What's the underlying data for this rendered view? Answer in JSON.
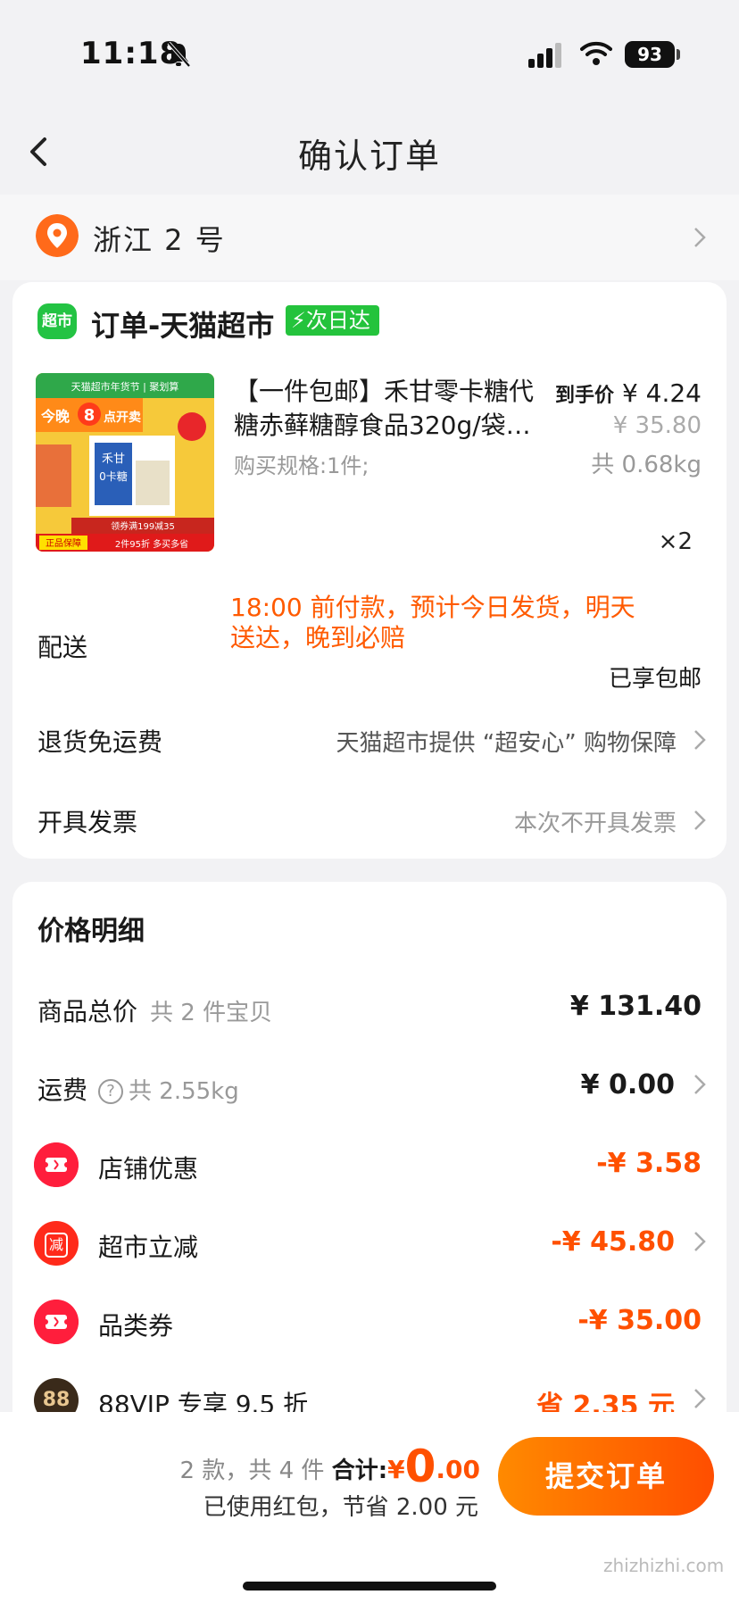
{
  "status_bar": {
    "time": "11:18",
    "battery": "93"
  },
  "nav": {
    "title": "确认订单"
  },
  "address": {
    "text": "浙江 2 号"
  },
  "order": {
    "shop_logo": "超市",
    "shop_name": "订单-天猫超市",
    "badge": "次日达",
    "product": {
      "title": "【一件包邮】禾甘零卡糖代糖赤藓糖醇食品320g/袋…",
      "spec": "购买规格:1件;",
      "final_price_label": "到手价",
      "final_price": "¥ 4.24",
      "original_price": "¥ 35.80",
      "weight": "共 0.68kg",
      "quantity": "×2",
      "image_texts": [
        "天猫超市年货节 | 聚划算",
        "今晚",
        "8",
        "点开卖",
        "禾甘",
        "0卡糖",
        "领券满199减35",
        "正品保障",
        "2件95折 多买多省"
      ]
    },
    "delivery": {
      "label": "配送",
      "note": "18:00 前付款，预计今日发货，明天送达，晚到必赔",
      "free_shipping": "已享包邮"
    },
    "returns": {
      "label": "退货免运费",
      "value": "天猫超市提供 “超安心” 购物保障"
    },
    "invoice": {
      "label": "开具发票",
      "value": "本次不开具发票"
    }
  },
  "price_detail": {
    "title": "价格明细",
    "goods_total": {
      "label": "商品总价",
      "sub": "共 2 件宝贝",
      "value": "¥ 131.40"
    },
    "shipping": {
      "label": "运费",
      "sub": "共 2.55kg",
      "value": "¥ 0.00"
    },
    "shop_discount": {
      "label": "店铺优惠",
      "value": "-¥ 3.58"
    },
    "market_cut": {
      "label": "超市立减",
      "icon_text": "减",
      "value": "-¥ 45.80"
    },
    "category_coupon": {
      "label": "品类券",
      "value": "-¥ 35.00"
    },
    "vip": {
      "label": "88VIP 专享 9.5 折",
      "icon_text": "88",
      "value": "省 2.35 元"
    }
  },
  "bottom": {
    "count_text": "2 款，共 4 件",
    "total_label": "合计:",
    "currency": "¥",
    "total_int": "0",
    "total_dec": ".00",
    "saved_text": "已使用红包，节省 2.00 元",
    "submit_label": "提交订单"
  },
  "watermark": "zhizhizhi.com",
  "colors": {
    "accent": "#ff5000",
    "green": "#24c33c",
    "red": "#ff1e3c"
  }
}
